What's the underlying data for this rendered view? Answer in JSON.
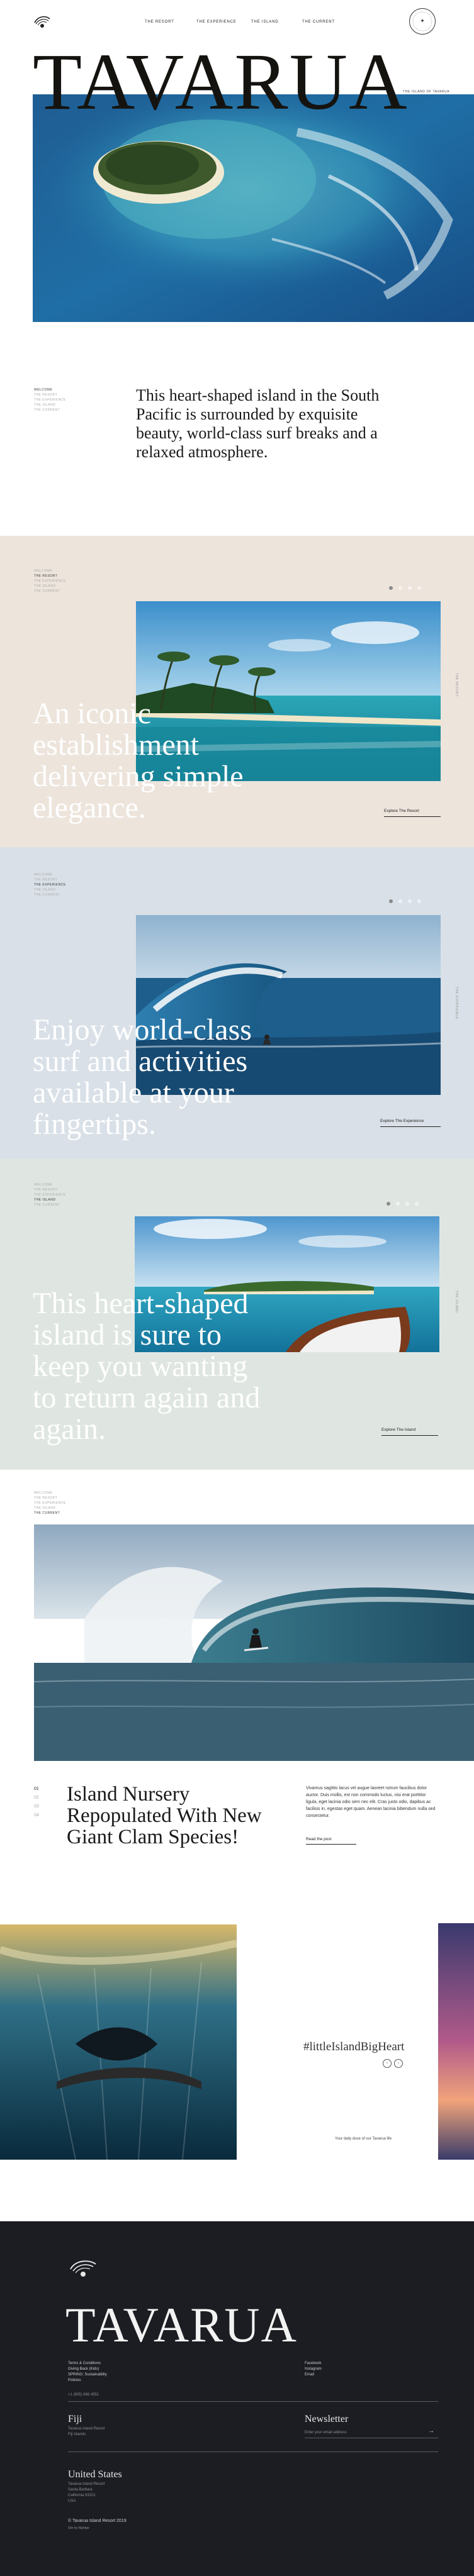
{
  "header": {
    "nav": [
      "THE RESORT",
      "THE EXPERIENCE",
      "THE ISLAND",
      "THE CURRENT"
    ],
    "seal_glyph": "✦"
  },
  "hero": {
    "title": "TAVARUA",
    "caption": "The Island of Tavarua"
  },
  "intro": {
    "menu": [
      "Welcome",
      "The Resort",
      "The Experience",
      "The Island",
      "The Current"
    ],
    "text": "This heart-shaped island in the South Pacific is surrounded by exquisite beauty, world-class surf breaks and a relaxed atmosphere."
  },
  "panels": [
    {
      "bg": "#ede4dc",
      "menu": [
        "Welcome",
        "The Resort",
        "The Experience",
        "The Island",
        "The Current"
      ],
      "active": 1,
      "big_text": "An iconic establishment delivering simple elegance.",
      "explore": "Explore The Resort",
      "vertical": "The Resort",
      "dots": 4,
      "current": 0
    },
    {
      "bg": "#d9e0e7",
      "menu": [
        "Welcome",
        "The Resort",
        "The Experience",
        "The Island",
        "The Current"
      ],
      "active": 2,
      "big_text": "Enjoy world-class surf and activities available at your fingertips.",
      "explore": "Explore The Experience",
      "vertical": "The Experience",
      "dots": 4,
      "current": 0
    },
    {
      "bg": "#dfe6e1",
      "menu": [
        "Welcome",
        "The Resort",
        "The Experience",
        "The Island",
        "The Current"
      ],
      "active": 3,
      "big_text": "This heart-shaped island is sure to keep you wanting to return again and again.",
      "explore": "Explore The Island",
      "vertical": "The Island",
      "dots": 4,
      "current": 0
    }
  ],
  "current": {
    "menu": [
      "Welcome",
      "The Resort",
      "The Experience",
      "The Island",
      "The Current"
    ],
    "active": 4,
    "pager": [
      "01",
      "02",
      "03",
      "04"
    ],
    "pager_current": 0,
    "article_title": "Island Nursery Repopulated With New Giant Clam Species!",
    "article_body": "Vivamus sagittis lacus vel augue laoreet rutrum faucibus dolor auctor. Duis mollis, est non commodo luctus, nisi erat porttitor ligula, eget lacinia odio sem nec elit. Cras justo odio, dapibus ac facilisis in, egestas eget quam. Aenean lacinia bibendum nulla sed consectetur.",
    "read_more": "Read the post"
  },
  "instagram": {
    "hashtag": "#littleIslandBigHeart",
    "prev": "‹",
    "next": "›",
    "caption": "Your daily dose of our Tavarua life"
  },
  "footer": {
    "title": "TAVARUA",
    "left_links": [
      "Terms & Conditions",
      "Giving Back (Kids)",
      "SPRING: Sustainability",
      "Policies"
    ],
    "phone": "+1 (805) 686 4551",
    "social": [
      "Facebook",
      "Instagram",
      "Email"
    ],
    "fiji_head": "Fiji",
    "fiji_lines": [
      "Tavarua Island Resort",
      "Fiji Islands"
    ],
    "newsletter_head": "Newsletter",
    "newsletter_placeholder": "Enter your email address",
    "newsletter_arrow": "→",
    "us_head": "United States",
    "us_lines": [
      "Tavarua Island Resort",
      "Santa Barbara",
      "California 93101",
      "USA"
    ],
    "copyright": "© Tavarua Island Resort 2019",
    "credits": "Site by Nightjar"
  }
}
